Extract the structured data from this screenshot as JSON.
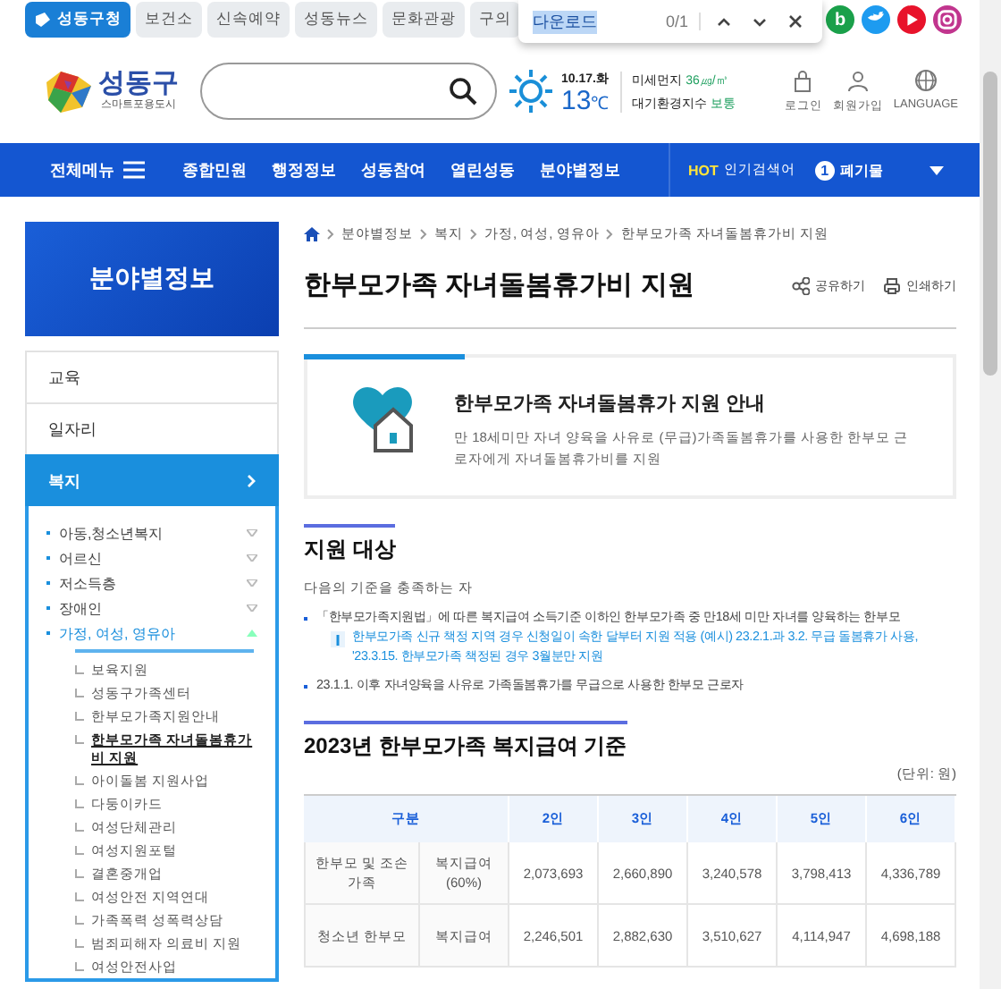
{
  "top_tabs": [
    {
      "label": "성동구청",
      "selected": true
    },
    {
      "label": "보건소",
      "selected": false
    },
    {
      "label": "신속예약",
      "selected": false
    },
    {
      "label": "성동뉴스",
      "selected": false
    },
    {
      "label": "문화관광",
      "selected": false
    },
    {
      "label": "구의",
      "selected": false
    }
  ],
  "find_bar": {
    "value": "다운로드",
    "count": "0/1"
  },
  "social": [
    {
      "kind": "blog",
      "label": "b"
    },
    {
      "kind": "twitter"
    },
    {
      "kind": "youtube"
    },
    {
      "kind": "instagram"
    }
  ],
  "header": {
    "logo_name": "성동구",
    "logo_slogan": "스마트포용도시",
    "weather": {
      "date": "10.17.화",
      "temp": "13",
      "unit": "℃"
    },
    "air": [
      {
        "label": "미세먼지",
        "value": "36㎍/㎥"
      },
      {
        "label": "대기환경지수",
        "value": "보통"
      }
    ],
    "utilities": [
      {
        "kind": "login",
        "label": "로그인"
      },
      {
        "kind": "join",
        "label": "회원가입"
      },
      {
        "kind": "language",
        "label": "LANGUAGE"
      }
    ]
  },
  "nav": {
    "all_menu": "전체메뉴",
    "items": [
      {
        "label": "종합민원"
      },
      {
        "label": "행정정보"
      },
      {
        "label": "성동참여"
      },
      {
        "label": "열린성동"
      },
      {
        "label": "분야별정보"
      }
    ],
    "hot_label": "HOT",
    "hot_title": "인기검색어",
    "hot_rank": "1",
    "hot_keyword": "폐기물"
  },
  "sidebar": {
    "title": "분야별정보",
    "items": [
      {
        "label": "교육",
        "selected": false
      },
      {
        "label": "일자리",
        "selected": false
      },
      {
        "label": "복지",
        "selected": true,
        "children": [
          {
            "label": "아동,청소년복지",
            "selected": false,
            "expanded": false
          },
          {
            "label": "어르신",
            "selected": false,
            "expanded": false
          },
          {
            "label": "저소득층",
            "selected": false,
            "expanded": false
          },
          {
            "label": "장애인",
            "selected": false,
            "expanded": false
          },
          {
            "label": "가정, 여성, 영유아",
            "selected": true,
            "expanded": true,
            "children": [
              {
                "label": "보육지원",
                "selected": false
              },
              {
                "label": "성동구가족센터",
                "selected": false
              },
              {
                "label": "한부모가족지원안내",
                "selected": false
              },
              {
                "label": "한부모가족 자녀돌봄휴가비 지원",
                "selected": true
              },
              {
                "label": "아이돌봄 지원사업",
                "selected": false
              },
              {
                "label": "다둥이카드",
                "selected": false
              },
              {
                "label": "여성단체관리",
                "selected": false
              },
              {
                "label": "여성지원포털",
                "selected": false
              },
              {
                "label": "결혼중개업",
                "selected": false
              },
              {
                "label": "여성안전 지역연대",
                "selected": false
              },
              {
                "label": "가족폭력 성폭력상담",
                "selected": false
              },
              {
                "label": "범죄피해자 의료비 지원",
                "selected": false
              },
              {
                "label": "여성안전사업",
                "selected": false
              }
            ]
          }
        ]
      }
    ]
  },
  "content": {
    "breadcrumb": [
      "분야별정보",
      "복지",
      "가정, 여성, 영유아",
      "한부모가족 자녀돌봄휴가비 지원"
    ],
    "title": "한부모가족 자녀돌봄휴가비 지원",
    "actions": [
      {
        "kind": "share",
        "label": "공유하기"
      },
      {
        "kind": "print",
        "label": "인쇄하기"
      }
    ],
    "intro": {
      "title": "한부모가족 자녀돌봄휴가 지원 안내",
      "text": "만 18세미만 자녀 양육을 사유로 (무급)가족돌봄휴가를 사용한 한부모 근로자에게 자녀돌봄휴가비를 지원"
    },
    "target": {
      "title": "지원 대상",
      "lead": "다음의 기준을 충족하는 자",
      "bullets": [
        {
          "text": "「한부모가족지원법」에 따른 복지급여 소득기준 이하인 한부모가족 중 만18세 미만 자녀를 양육하는 한부모",
          "notes": [
            "한부모가족 신규 책정 지역 경우 신청일이 속한 달부터 지원 적용 (예시) 23.2.1.과 3.2. 무급 돌봄휴가 사용, '23.3.15. 한부모가족 책정된 경우 3월분만 지원"
          ]
        },
        {
          "text": "23.1.1. 이후 자녀양육을 사유로 가족돌봄휴가를 무급으로 사용한 한부모 근로자"
        }
      ]
    },
    "standard": {
      "title": "2023년 한부모가족 복지급여 기준",
      "unit": "(단위: 원)",
      "columns": [
        "구분",
        "2인",
        "3인",
        "4인",
        "5인",
        "6인"
      ],
      "rows": [
        {
          "group": "한부모 및 조손 가족",
          "type": "복지급여 (60%)",
          "values": [
            "2,073,693",
            "2,660,890",
            "3,240,578",
            "3,798,413",
            "4,336,789"
          ]
        },
        {
          "group": "청소년 한부모",
          "type": "복지급여",
          "values": [
            "2,246,501",
            "2,882,630",
            "3,510,627",
            "4,114,947",
            "4,698,188"
          ]
        }
      ]
    }
  }
}
